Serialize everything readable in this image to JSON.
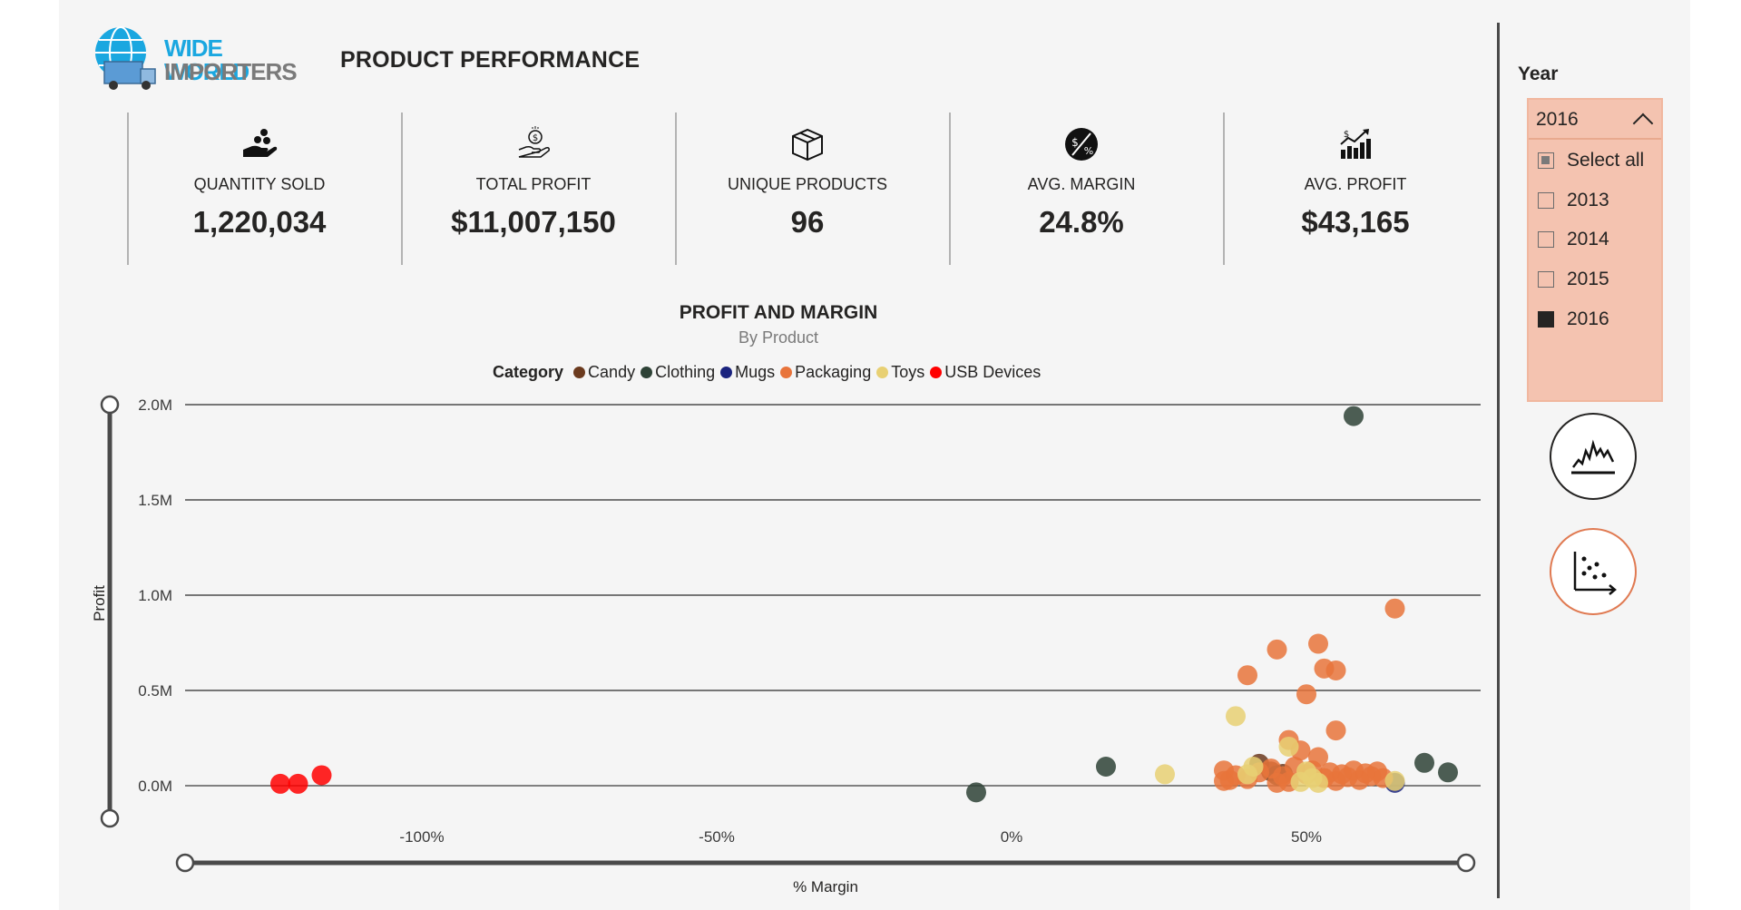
{
  "header": {
    "logo_line1": "WIDE WORLD",
    "logo_line2": "IMPORTERS",
    "page_title": "PRODUCT PERFORMANCE"
  },
  "kpis": [
    {
      "icon": "hand-coins-icon",
      "label": "QUANTITY SOLD",
      "value": "1,220,034"
    },
    {
      "icon": "hand-dollar-icon",
      "label": "TOTAL PROFIT",
      "value": "$11,007,150"
    },
    {
      "icon": "box-icon",
      "label": "UNIQUE PRODUCTS",
      "value": "96"
    },
    {
      "icon": "percent-dollar-icon",
      "label": "AVG. MARGIN",
      "value": "24.8%"
    },
    {
      "icon": "growth-chart-icon",
      "label": "AVG. PROFIT",
      "value": "$43,165"
    }
  ],
  "slicer": {
    "title": "Year",
    "selected": "2016",
    "options": [
      {
        "label": "Select all",
        "state": "partial"
      },
      {
        "label": "2013",
        "state": "unchecked"
      },
      {
        "label": "2014",
        "state": "unchecked"
      },
      {
        "label": "2015",
        "state": "unchecked"
      },
      {
        "label": "2016",
        "state": "checked"
      }
    ]
  },
  "buttons": {
    "line_chart_icon": "line-chart-icon",
    "scatter_chart_icon": "scatter-chart-icon"
  },
  "chart_data": {
    "type": "scatter",
    "title": "PROFIT AND MARGIN",
    "subtitle": "By Product",
    "xlabel": "% Margin",
    "ylabel": "Profit",
    "legend_title": "Category",
    "legend_position": "top-center",
    "xlim": [
      -150,
      80
    ],
    "ylim": [
      -200000,
      2000000
    ],
    "x_ticks": [
      {
        "value": -100,
        "label": "-100%"
      },
      {
        "value": -50,
        "label": "-50%"
      },
      {
        "value": 0,
        "label": "0%"
      },
      {
        "value": 50,
        "label": "50%"
      }
    ],
    "y_ticks": [
      {
        "value": 0,
        "label": "0.0M"
      },
      {
        "value": 500000,
        "label": "0.5M"
      },
      {
        "value": 1000000,
        "label": "1.0M"
      },
      {
        "value": 1500000,
        "label": "1.5M"
      },
      {
        "value": 2000000,
        "label": "2.0M"
      }
    ],
    "grid": true,
    "series": [
      {
        "name": "Candy",
        "color": "#6b3a1e",
        "points": [
          [
            42,
            115000
          ],
          [
            44,
            75000
          ],
          [
            46,
            62000
          ]
        ]
      },
      {
        "name": "Clothing",
        "color": "#2e4236",
        "points": [
          [
            58,
            1940000
          ],
          [
            -6,
            -35000
          ],
          [
            16,
            100000
          ],
          [
            70,
            120000
          ],
          [
            74,
            70000
          ],
          [
            45,
            55000
          ]
        ]
      },
      {
        "name": "Mugs",
        "color": "#1a237e",
        "points": [
          [
            65,
            15000
          ]
        ]
      },
      {
        "name": "Packaging",
        "color": "#e8743b",
        "points": [
          [
            65,
            930000
          ],
          [
            45,
            715000
          ],
          [
            52,
            745000
          ],
          [
            53,
            615000
          ],
          [
            55,
            605000
          ],
          [
            40,
            580000
          ],
          [
            50,
            480000
          ],
          [
            55,
            290000
          ],
          [
            47,
            240000
          ],
          [
            49,
            185000
          ],
          [
            52,
            150000
          ],
          [
            36,
            80000
          ],
          [
            37,
            30000
          ],
          [
            38,
            55000
          ],
          [
            40,
            35000
          ],
          [
            42,
            70000
          ],
          [
            44,
            90000
          ],
          [
            46,
            50000
          ],
          [
            47,
            20000
          ],
          [
            48,
            100000
          ],
          [
            50,
            60000
          ],
          [
            51,
            80000
          ],
          [
            53,
            40000
          ],
          [
            54,
            70000
          ],
          [
            55,
            25000
          ],
          [
            56,
            60000
          ],
          [
            57,
            45000
          ],
          [
            58,
            80000
          ],
          [
            59,
            30000
          ],
          [
            60,
            65000
          ],
          [
            61,
            50000
          ],
          [
            62,
            75000
          ],
          [
            63,
            40000
          ],
          [
            36,
            25000
          ],
          [
            45,
            15000
          ]
        ]
      },
      {
        "name": "Toys",
        "color": "#e8d073",
        "points": [
          [
            38,
            365000
          ],
          [
            26,
            60000
          ],
          [
            47,
            205000
          ],
          [
            41,
            100000
          ],
          [
            40,
            60000
          ],
          [
            50,
            75000
          ],
          [
            51,
            40000
          ],
          [
            52,
            15000
          ],
          [
            65,
            25000
          ],
          [
            49,
            20000
          ]
        ]
      },
      {
        "name": "USB Devices",
        "color": "#ff0000",
        "points": [
          [
            -124,
            10000
          ],
          [
            -121,
            10000
          ],
          [
            -117,
            55000
          ]
        ]
      }
    ]
  }
}
